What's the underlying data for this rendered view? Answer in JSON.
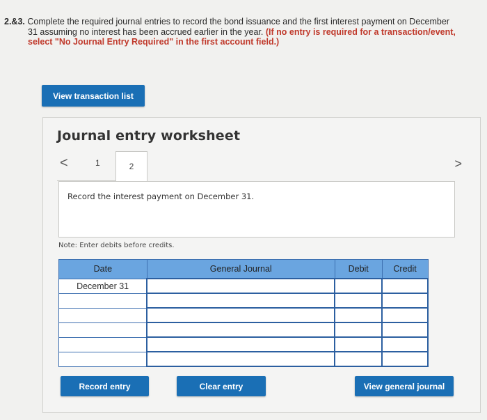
{
  "question": {
    "number": "2.&3.",
    "line1": "Complete the required journal entries to record the bond issuance and the first interest payment on December",
    "line2_plain": "31 assuming no interest has been accrued earlier in the year.",
    "line2_red": "(If no entry is required for a transaction/event,",
    "line3_red": "select \"No Journal Entry Required\" in the first account field.)"
  },
  "buttons": {
    "view_transactions": "View transaction list",
    "record_entry": "Record entry",
    "clear_entry": "Clear entry",
    "view_journal": "View general journal"
  },
  "worksheet": {
    "title": "Journal entry worksheet",
    "tabs": [
      "1",
      "2"
    ],
    "active_tab": "2",
    "prev_icon": "<",
    "next_icon": ">",
    "description": "Record the interest payment on December 31.",
    "note": "Note: Enter debits before credits."
  },
  "journal": {
    "headers": [
      "Date",
      "General Journal",
      "Debit",
      "Credit"
    ],
    "rows": [
      {
        "date": "December 31",
        "account": "",
        "debit": "",
        "credit": ""
      },
      {
        "date": "",
        "account": "",
        "debit": "",
        "credit": ""
      },
      {
        "date": "",
        "account": "",
        "debit": "",
        "credit": ""
      },
      {
        "date": "",
        "account": "",
        "debit": "",
        "credit": ""
      },
      {
        "date": "",
        "account": "",
        "debit": "",
        "credit": ""
      },
      {
        "date": "",
        "account": "",
        "debit": "",
        "credit": ""
      }
    ]
  },
  "colors": {
    "button_blue": "#1a6fb5",
    "header_blue": "#6aa5e0",
    "instruction_red": "#c0392b"
  }
}
